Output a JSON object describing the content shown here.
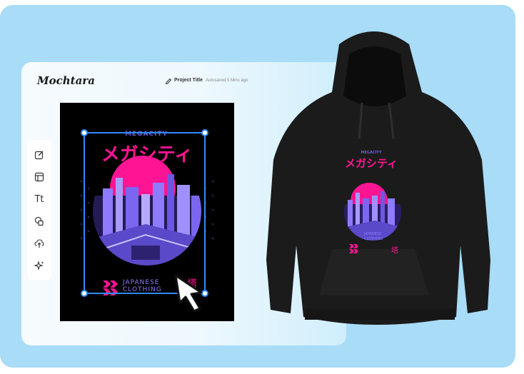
{
  "editor": {
    "brand": "Mochtara",
    "project_title": "Project Title",
    "autosave_status": "Autosaved 5 Mins ago"
  },
  "toolbar": {
    "tools": [
      {
        "icon": "edit-icon"
      },
      {
        "icon": "template-icon"
      },
      {
        "icon": "text-icon",
        "label": "Tt"
      },
      {
        "icon": "shapes-icon"
      },
      {
        "icon": "upload-icon"
      },
      {
        "icon": "ai-sparkle-icon"
      }
    ]
  },
  "design": {
    "heading_small": "MEGACITY",
    "heading_jp": "メガシティ",
    "brand_line1": "JAPANESE",
    "brand_line2": "CLOTHING"
  },
  "colors": {
    "background": "#a8dcf7",
    "accent_pink": "#ff1493",
    "accent_purple": "#8e7bff",
    "selection_blue": "#2f8cff"
  }
}
